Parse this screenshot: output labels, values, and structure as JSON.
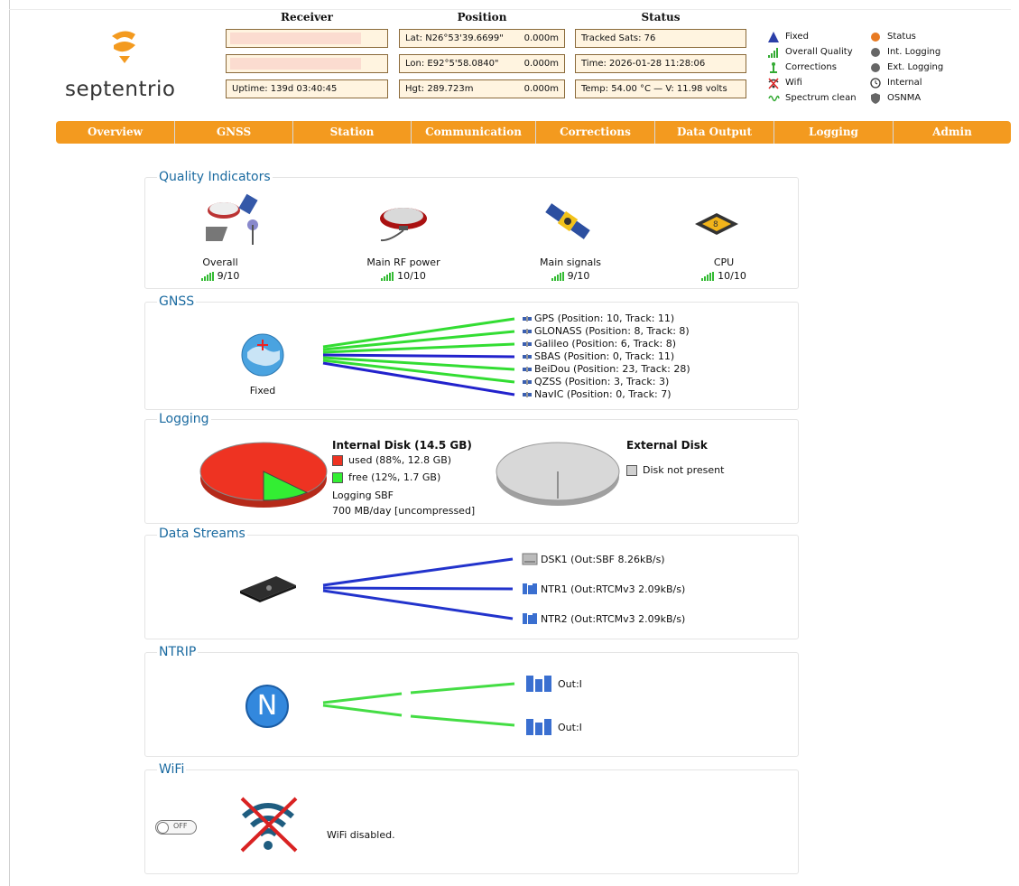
{
  "brand": {
    "name": "septentrio"
  },
  "header": {
    "receiver_title": "Receiver",
    "position_title": "Position",
    "status_title": "Status",
    "uptime": "Uptime: 139d 03:40:45",
    "lat_label": "Lat:",
    "lat_value": "N26°53'39.6699\"",
    "lat_sd": "0.000m",
    "lon_label": "Lon:",
    "lon_value": "E92°5'58.0840\"",
    "lon_sd": "0.000m",
    "hgt_label": "Hgt:",
    "hgt_value": "289.723m",
    "hgt_sd": "0.000m",
    "tracked_sats": "Tracked Sats: 76",
    "time": "Time: 2026-01-28 11:28:06",
    "temp": "Temp: 54.00 °C — V: 11.98 volts"
  },
  "legend": {
    "left": [
      {
        "label": "Fixed",
        "icon": "triangle-icon"
      },
      {
        "label": "Overall Quality",
        "icon": "signal-bars-icon"
      },
      {
        "label": "Corrections",
        "icon": "antenna-icon"
      },
      {
        "label": "Wifi",
        "icon": "wifi-off-icon"
      },
      {
        "label": "Spectrum clean",
        "icon": "spectrum-icon"
      }
    ],
    "right": [
      {
        "label": "Status",
        "icon": "status-icon"
      },
      {
        "label": "Int. Logging",
        "icon": "disk-icon"
      },
      {
        "label": "Ext. Logging",
        "icon": "disk-icon"
      },
      {
        "label": "Internal",
        "icon": "clock-icon"
      },
      {
        "label": "OSNMA",
        "icon": "shield-icon"
      }
    ]
  },
  "nav": [
    "Overview",
    "GNSS",
    "Station",
    "Communication",
    "Corrections",
    "Data Output",
    "Logging",
    "Admin"
  ],
  "sections": {
    "quality": "Quality Indicators",
    "gnss": "GNSS",
    "logging": "Logging",
    "streams": "Data Streams",
    "ntrip": "NTRIP",
    "wifi": "WiFi"
  },
  "quality": [
    {
      "label": "Overall",
      "value": "9/10",
      "level": 9
    },
    {
      "label": "Main RF power",
      "value": "10/10",
      "level": 10
    },
    {
      "label": "Main signals",
      "value": "9/10",
      "level": 9
    },
    {
      "label": "CPU",
      "value": "10/10",
      "level": 10
    }
  ],
  "gnss": {
    "fix_label": "Fixed",
    "constellations": [
      {
        "text": "GPS (Position: 10, Track: 11)",
        "color": "#33dd33"
      },
      {
        "text": "GLONASS (Position: 8, Track: 8)",
        "color": "#33dd33"
      },
      {
        "text": "Galileo (Position: 6, Track: 8)",
        "color": "#33dd33"
      },
      {
        "text": "SBAS (Position: 0, Track: 11)",
        "color": "#2222cc"
      },
      {
        "text": "BeiDou (Position: 23, Track: 28)",
        "color": "#33dd33"
      },
      {
        "text": "QZSS (Position: 3, Track: 3)",
        "color": "#33dd33"
      },
      {
        "text": "NavIC (Position: 0, Track: 7)",
        "color": "#2222cc"
      }
    ]
  },
  "logging": {
    "internal_title": "Internal Disk (14.5 GB)",
    "used_label": "used (88%, 12.8 GB)",
    "used_fraction": 0.88,
    "free_label": "free (12%, 1.7 GB)",
    "free_fraction": 0.12,
    "used_color": "#ee3322",
    "free_color": "#33ee33",
    "mode": "Logging SBF",
    "rate": "700 MB/day [uncompressed]",
    "external_title": "External Disk",
    "external_status": "Disk not present"
  },
  "streams": [
    {
      "label": "DSK1 (Out:SBF 8.26kB/s)",
      "icon": "disk-icon"
    },
    {
      "label": "NTR1 (Out:RTCMv3 2.09kB/s)",
      "icon": "network-icon"
    },
    {
      "label": "NTR2 (Out:RTCMv3 2.09kB/s)",
      "icon": "network-icon"
    }
  ],
  "ntrip": {
    "badge": "N",
    "outputs": [
      "Out:I",
      "Out:I"
    ]
  },
  "wifi": {
    "toggle_label": "OFF",
    "status": "WiFi disabled."
  }
}
